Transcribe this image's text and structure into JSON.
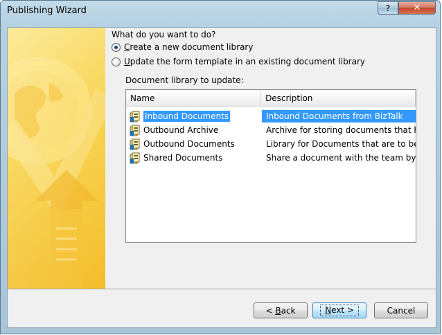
{
  "window": {
    "title": "Publishing Wizard",
    "help_label": "?",
    "close_label": "✕"
  },
  "main": {
    "question": "What do you want to do?",
    "options": [
      {
        "label_prefix": "",
        "mnemonic": "C",
        "label_rest": "reate a new document library",
        "checked": true
      },
      {
        "label_prefix": "",
        "mnemonic": "U",
        "label_rest": "pdate the form template in an existing document library",
        "checked": false
      }
    ],
    "library_label": "Document library to update:",
    "columns": [
      "Name",
      "Description"
    ],
    "libraries": [
      {
        "name": "Inbound Documents",
        "description": "Inbound Documents from BizTalk",
        "selected": true
      },
      {
        "name": "Outbound Archive",
        "description": "Archive for storing documents that ha...",
        "selected": false
      },
      {
        "name": "Outbound Documents",
        "description": "Library for Documents that are to be ...",
        "selected": false
      },
      {
        "name": "Shared Documents",
        "description": "Share a document with the team by a...",
        "selected": false
      }
    ]
  },
  "footer": {
    "back": {
      "prefix": "< ",
      "mnemonic": "B",
      "rest": "ack"
    },
    "next": {
      "prefix": "",
      "mnemonic": "N",
      "rest": "ext >"
    },
    "cancel": "Cancel"
  },
  "icons": {
    "library": "document-library-icon",
    "help": "help-icon",
    "close": "close-icon"
  },
  "colors": {
    "selection": "#3399ff",
    "side_art_yellow": "#f8d54b",
    "title_bar": "#b6d1e2"
  }
}
